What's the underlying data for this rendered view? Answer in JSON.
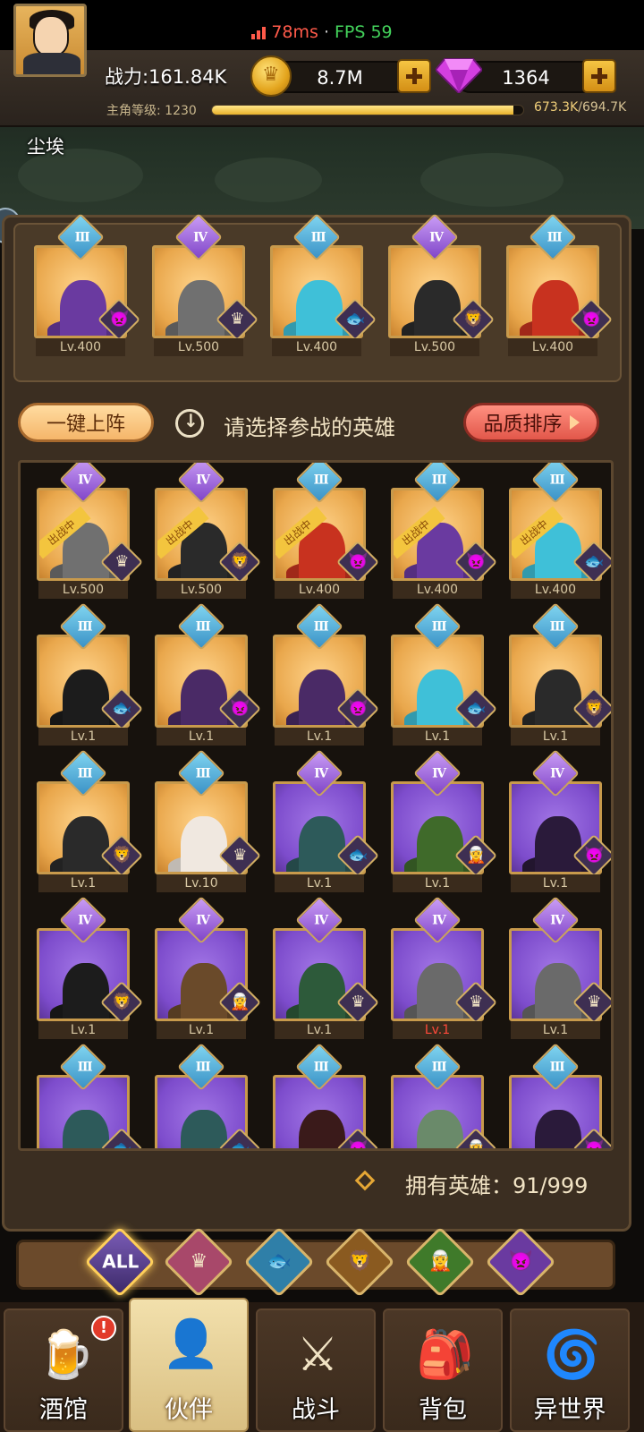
{
  "status": {
    "ping": "78ms",
    "separator": "·",
    "fps": "FPS 59"
  },
  "player": {
    "name": "尘埃",
    "power": "战力:161.84K",
    "level_label": "主角等级: ",
    "level": "1230",
    "xp_current": "673.3K",
    "xp_max": "/694.7K",
    "xp_progress": 0.969
  },
  "resources": {
    "gold": "8.7M",
    "gems": "1364"
  },
  "toolbar": {
    "one_key_label": "一键上阵",
    "hint": "请选择参战的英雄",
    "sort_label": "品质排序"
  },
  "owned": "拥有英雄：91/999",
  "deployed_tag": "出战中",
  "lineup": [
    {
      "rank": "Ⅲ",
      "tier": "r3",
      "bg": "gold",
      "lv": "Lv.400",
      "faction": "👿",
      "color": "#6a3aa0"
    },
    {
      "rank": "Ⅳ",
      "tier": "r4",
      "bg": "gold",
      "lv": "Lv.500",
      "faction": "♛",
      "color": "#707070"
    },
    {
      "rank": "Ⅲ",
      "tier": "r3",
      "bg": "gold",
      "lv": "Lv.400",
      "faction": "🐟",
      "color": "#3fc0d8"
    },
    {
      "rank": "Ⅳ",
      "tier": "r4",
      "bg": "gold",
      "lv": "Lv.500",
      "faction": "🦁",
      "color": "#2a2a2a"
    },
    {
      "rank": "Ⅲ",
      "tier": "r3",
      "bg": "gold",
      "lv": "Lv.400",
      "faction": "👿",
      "color": "#c8321f"
    }
  ],
  "heroes": [
    {
      "rank": "Ⅳ",
      "tier": "r4",
      "bg": "gold",
      "lv": "Lv.500",
      "faction": "♛",
      "color": "#707070",
      "deployed": true
    },
    {
      "rank": "Ⅳ",
      "tier": "r4",
      "bg": "gold",
      "lv": "Lv.500",
      "faction": "🦁",
      "color": "#2a2a2a",
      "deployed": true
    },
    {
      "rank": "Ⅲ",
      "tier": "r3",
      "bg": "gold",
      "lv": "Lv.400",
      "faction": "👿",
      "color": "#c8321f",
      "deployed": true
    },
    {
      "rank": "Ⅲ",
      "tier": "r3",
      "bg": "gold",
      "lv": "Lv.400",
      "faction": "👿",
      "color": "#6a3aa0",
      "deployed": true
    },
    {
      "rank": "Ⅲ",
      "tier": "r3",
      "bg": "gold",
      "lv": "Lv.400",
      "faction": "🐟",
      "color": "#3fc0d8",
      "deployed": true
    },
    {
      "rank": "Ⅲ",
      "tier": "r3",
      "bg": "gold",
      "lv": "Lv.1",
      "faction": "🐟",
      "color": "#1c1c1c"
    },
    {
      "rank": "Ⅲ",
      "tier": "r3",
      "bg": "gold",
      "lv": "Lv.1",
      "faction": "👿",
      "color": "#4a2a66"
    },
    {
      "rank": "Ⅲ",
      "tier": "r3",
      "bg": "gold",
      "lv": "Lv.1",
      "faction": "👿",
      "color": "#4a2a66"
    },
    {
      "rank": "Ⅲ",
      "tier": "r3",
      "bg": "gold",
      "lv": "Lv.1",
      "faction": "🐟",
      "color": "#3fc0d8"
    },
    {
      "rank": "Ⅲ",
      "tier": "r3",
      "bg": "gold",
      "lv": "Lv.1",
      "faction": "🦁",
      "color": "#2a2a2a"
    },
    {
      "rank": "Ⅲ",
      "tier": "r3",
      "bg": "gold",
      "lv": "Lv.1",
      "faction": "🦁",
      "color": "#2a2a2a"
    },
    {
      "rank": "Ⅲ",
      "tier": "r3",
      "bg": "gold",
      "lv": "Lv.10",
      "faction": "♛",
      "color": "#f0e8e0"
    },
    {
      "rank": "Ⅳ",
      "tier": "r4",
      "bg": "purple",
      "lv": "Lv.1",
      "faction": "🐟",
      "color": "#2d5a5a"
    },
    {
      "rank": "Ⅳ",
      "tier": "r4",
      "bg": "purple",
      "lv": "Lv.1",
      "faction": "🧝",
      "color": "#3f6a2a"
    },
    {
      "rank": "Ⅳ",
      "tier": "r4",
      "bg": "purple",
      "lv": "Lv.1",
      "faction": "👿",
      "color": "#2a1a3a"
    },
    {
      "rank": "Ⅳ",
      "tier": "r4",
      "bg": "purple",
      "lv": "Lv.1",
      "faction": "🦁",
      "color": "#1c1c1c"
    },
    {
      "rank": "Ⅳ",
      "tier": "r4",
      "bg": "purple",
      "lv": "Lv.1",
      "faction": "🧝",
      "color": "#6a4a2a"
    },
    {
      "rank": "Ⅳ",
      "tier": "r4",
      "bg": "purple",
      "lv": "Lv.1",
      "faction": "♛",
      "color": "#2d5a3a"
    },
    {
      "rank": "Ⅳ",
      "tier": "r4",
      "bg": "purple",
      "lv": "Lv.1",
      "faction": "♛",
      "color": "#6a6a6a",
      "red": true
    },
    {
      "rank": "Ⅳ",
      "tier": "r4",
      "bg": "purple",
      "lv": "Lv.1",
      "faction": "♛",
      "color": "#6a6a6a"
    },
    {
      "rank": "Ⅲ",
      "tier": "r3",
      "bg": "purple",
      "lv": "",
      "faction": "🐟",
      "color": "#2d5a5a"
    },
    {
      "rank": "Ⅲ",
      "tier": "r3",
      "bg": "purple",
      "lv": "",
      "faction": "🐟",
      "color": "#2d5a5a"
    },
    {
      "rank": "Ⅲ",
      "tier": "r3",
      "bg": "purple",
      "lv": "",
      "faction": "👿",
      "color": "#3a1a1a"
    },
    {
      "rank": "Ⅲ",
      "tier": "r3",
      "bg": "purple",
      "lv": "",
      "faction": "🧝",
      "color": "#6a8a6a"
    },
    {
      "rank": "Ⅲ",
      "tier": "r3",
      "bg": "purple",
      "lv": "",
      "faction": "👿",
      "color": "#2a1a3a"
    }
  ],
  "filters": [
    {
      "label": "ALL",
      "icon": "all-icon"
    },
    {
      "label": "♛",
      "icon": "crown-faction-icon"
    },
    {
      "label": "🐟",
      "icon": "fish-faction-icon"
    },
    {
      "label": "🦁",
      "icon": "lion-faction-icon"
    },
    {
      "label": "🧝",
      "icon": "elf-faction-icon"
    },
    {
      "label": "👿",
      "icon": "demon-faction-icon"
    }
  ],
  "nav": [
    {
      "label": "酒馆",
      "glyph": "🍺",
      "icon": "tavern-icon",
      "alert": "!"
    },
    {
      "label": "伙伴",
      "glyph": "👤",
      "icon": "partner-icon",
      "active": true
    },
    {
      "label": "战斗",
      "glyph": "⚔",
      "icon": "battle-icon"
    },
    {
      "label": "背包",
      "glyph": "🎒",
      "icon": "backpack-icon"
    },
    {
      "label": "异世界",
      "glyph": "🌀",
      "icon": "otherworld-icon"
    }
  ]
}
